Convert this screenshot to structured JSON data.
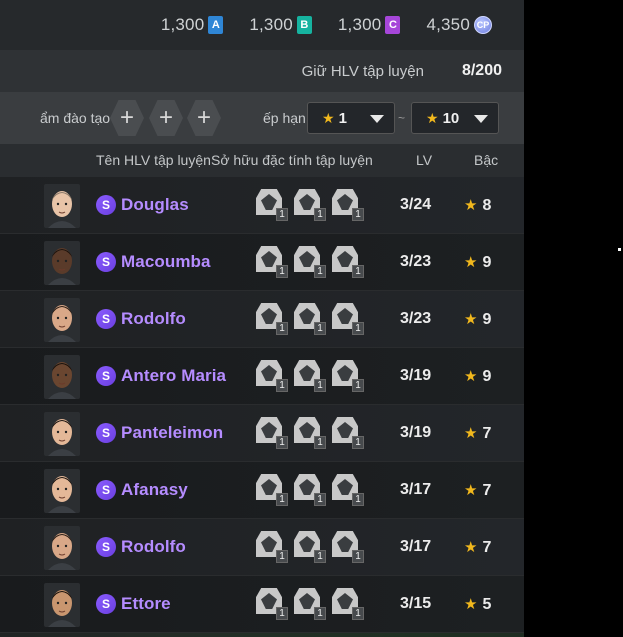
{
  "currency": [
    {
      "value": "1,300",
      "badge": "A",
      "color": "#2f86d6"
    },
    {
      "value": "1,300",
      "badge": "B",
      "color": "#16b3a0"
    },
    {
      "value": "1,300",
      "badge": "C",
      "color": "#a646d9"
    },
    {
      "value": "4,350",
      "badge": "CP",
      "color": "#7f8ff0"
    }
  ],
  "coach_count": {
    "label": "Giữ HLV tập luyện",
    "value": "8/200"
  },
  "filters": {
    "training_label": "ẩm đào tạo",
    "plus": "+",
    "rank_label": "ếp hạn",
    "rank_from": "1",
    "tilde": "~",
    "rank_to": "10"
  },
  "columns": {
    "name": "Tên HLV tập luyện",
    "traits": "Sở hữu đặc tính tập luyện",
    "lv": "LV",
    "rank": "Bậc"
  },
  "coaches": [
    {
      "name": "Douglas",
      "lv": "3/24",
      "rank": "8",
      "skin": "#e8c4a8",
      "hair": "#8a7a6a",
      "traits": [
        "1",
        "1",
        "1"
      ]
    },
    {
      "name": "Macoumba",
      "lv": "3/23",
      "rank": "9",
      "skin": "#5a3b2a",
      "hair": "#1e140e",
      "traits": [
        "1",
        "1",
        "1"
      ]
    },
    {
      "name": "Rodolfo",
      "lv": "3/23",
      "rank": "9",
      "skin": "#d9a888",
      "hair": "#2b1e16",
      "traits": [
        "1",
        "1",
        "1"
      ]
    },
    {
      "name": "Antero Maria",
      "lv": "3/19",
      "rank": "9",
      "skin": "#6a4630",
      "hair": "#1a120c",
      "traits": [
        "1",
        "1",
        "1"
      ]
    },
    {
      "name": "Panteleimon",
      "lv": "3/19",
      "rank": "7",
      "skin": "#e4b898",
      "hair": "#1c1410",
      "traits": [
        "1",
        "1",
        "1"
      ]
    },
    {
      "name": "Afanasy",
      "lv": "3/17",
      "rank": "7",
      "skin": "#e4b898",
      "hair": "#1c1410",
      "traits": [
        "1",
        "1",
        "1"
      ]
    },
    {
      "name": "Rodolfo",
      "lv": "3/17",
      "rank": "7",
      "skin": "#d9a888",
      "hair": "#2b1e16",
      "traits": [
        "1",
        "1",
        "1"
      ]
    },
    {
      "name": "Ettore",
      "lv": "3/15",
      "rank": "5",
      "skin": "#c9966f",
      "hair": "#1a120c",
      "traits": [
        "1",
        "1",
        "1"
      ]
    }
  ],
  "badge_letter": "S"
}
